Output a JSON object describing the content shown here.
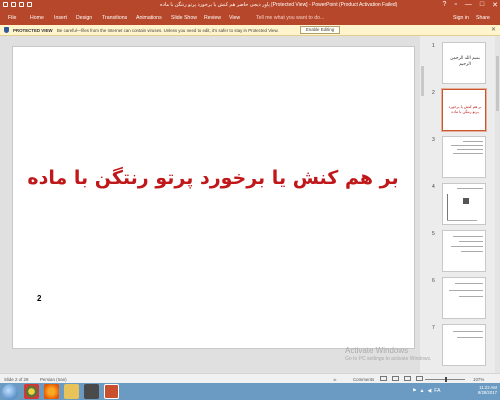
{
  "window": {
    "title": "پاور دیجی حاضر هم کنش یا برخورد پرتو رنتگن با ماده [Protected View] - PowerPoint (Product Activation Failed)",
    "controls": [
      "?",
      "▫",
      "—",
      "□",
      "✕"
    ]
  },
  "ribbon": {
    "tabs": [
      "File",
      "Home",
      "Insert",
      "Design",
      "Transitions",
      "Animations",
      "Slide Show",
      "Review",
      "View"
    ],
    "tell_me": "Tell me what you want to do...",
    "sign_in": "Sign in",
    "share": "Share"
  },
  "protected_view": {
    "label": "PROTECTED VIEW",
    "message": "Be careful—files from the Internet can contain viruses. Unless you need to edit, it's safer to stay in Protected View.",
    "button": "Enable Editing",
    "close": "✕"
  },
  "slide": {
    "heading": "بر هم کنش یا برخورد پرتو رنتگن با ماده",
    "number": "2"
  },
  "thumbnails": [
    {
      "num": "1",
      "text": "بسم الله الرحمن الرحیم"
    },
    {
      "num": "2",
      "text": "بر هم کنش یا برخورد پرتو رنتگن با ماده"
    },
    {
      "num": "3",
      "text": ""
    },
    {
      "num": "4",
      "text": ""
    },
    {
      "num": "5",
      "text": ""
    },
    {
      "num": "6",
      "text": ""
    },
    {
      "num": "7",
      "text": ""
    }
  ],
  "watermark": {
    "title": "Activate Windows",
    "subtitle": "Go to PC settings to activate Windows."
  },
  "statusbar": {
    "slide_info": "Slide 2 of 28",
    "language": "Persian (Iran)",
    "notes": "≐",
    "comments": "Comments",
    "zoom": "107%"
  },
  "taskbar": {
    "time": "11:22 AM",
    "date": "9/28/2017",
    "lang": "FA"
  }
}
